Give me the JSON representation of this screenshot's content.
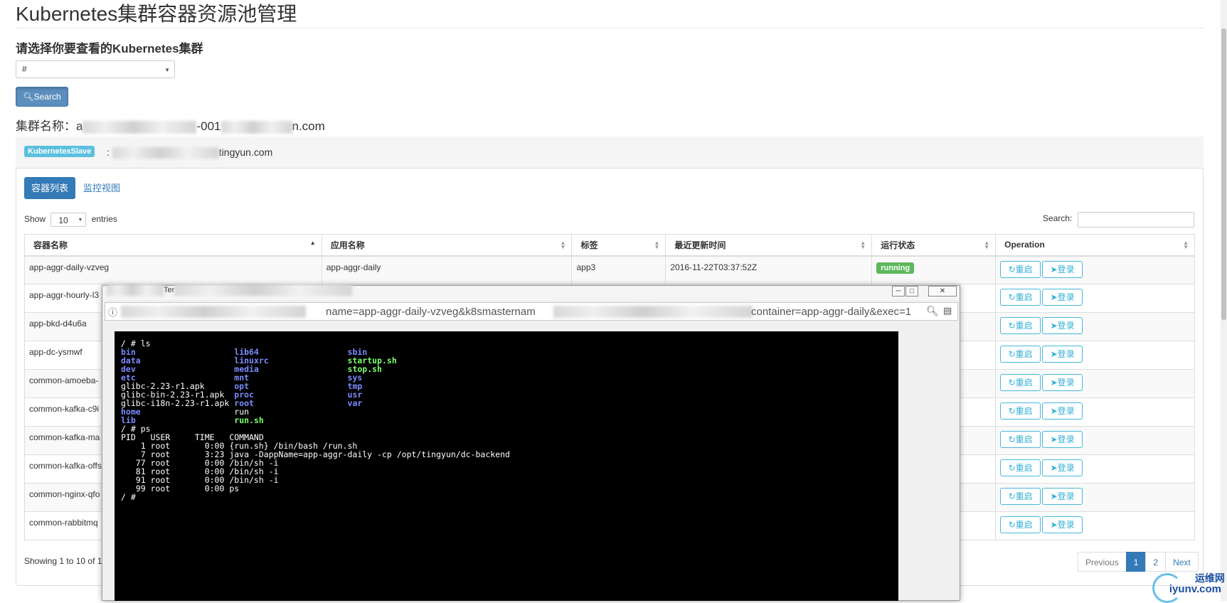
{
  "header": {
    "title": "Kubernetes集群容器资源池管理",
    "select_label": "请选择你要查看的Kubernetes集群",
    "select_value": "#",
    "search_button": "Search",
    "cluster_label": "集群名称：",
    "cluster_name_prefix": "a",
    "cluster_name_mid": "-001",
    "cluster_name_suffix": "n.com"
  },
  "panel": {
    "badge": "KubernetesSlave",
    "colon": ":",
    "host_suffix": "tingyun.com"
  },
  "tabs": {
    "list": "容器列表",
    "monitor": "监控视图"
  },
  "table_controls": {
    "show": "Show",
    "page_size": "10",
    "entries": "entries",
    "search_label": "Search:"
  },
  "table": {
    "columns": [
      "容器名称",
      "应用名称",
      "标签",
      "最近更新时间",
      "运行状态",
      "Operation"
    ],
    "rows": [
      {
        "name": "app-aggr-daily-vzveg",
        "app": "app-aggr-daily",
        "tag": "app3",
        "updated": "2016-11-22T03:37:52Z",
        "status": "running"
      },
      {
        "name": "app-aggr-hourly-l3",
        "app": "",
        "tag": "",
        "updated": "",
        "status": ""
      },
      {
        "name": "app-bkd-d4u6a",
        "app": "",
        "tag": "",
        "updated": "",
        "status": ""
      },
      {
        "name": "app-dc-ysmwf",
        "app": "",
        "tag": "",
        "updated": "",
        "status": ""
      },
      {
        "name": "common-amoeba-",
        "app": "",
        "tag": "",
        "updated": "",
        "status": ""
      },
      {
        "name": "common-kafka-c9i",
        "app": "",
        "tag": "",
        "updated": "",
        "status": ""
      },
      {
        "name": "common-kafka-ma",
        "app": "",
        "tag": "",
        "updated": "",
        "status": ""
      },
      {
        "name": "common-kafka-offs",
        "app": "",
        "tag": "",
        "updated": "",
        "status": ""
      },
      {
        "name": "common-nginx-qfo",
        "app": "",
        "tag": "",
        "updated": "",
        "status": ""
      },
      {
        "name": "common-rabbitmq",
        "app": "",
        "tag": "",
        "updated": "",
        "status": ""
      }
    ],
    "restart_label": "重启",
    "login_label": "登录"
  },
  "footer": {
    "showing": "Showing 1 to 10 of 1",
    "previous": "Previous",
    "page1": "1",
    "page2": "2",
    "next": "Next"
  },
  "popup": {
    "title_fragment": "Ter",
    "url_visible": "name=app-aggr-daily-vzveg&k8smasternam",
    "url_tail": "container=app-aggr-daily&exec=1",
    "terminal": {
      "prompt_ls": "/ # ls",
      "ls_col1": [
        [
          "bin",
          "dir"
        ],
        [
          "data",
          "dir"
        ],
        [
          "dev",
          "dir"
        ],
        [
          "etc",
          "dir"
        ],
        [
          "glibc-2.23-r1.apk",
          ""
        ],
        [
          "glibc-bin-2.23-r1.apk",
          ""
        ],
        [
          "glibc-i18n-2.23-r1.apk",
          ""
        ],
        [
          "home",
          "dir"
        ],
        [
          "lib",
          "dir"
        ]
      ],
      "ls_col2": [
        [
          "lib64",
          "dir"
        ],
        [
          "linuxrc",
          "dir"
        ],
        [
          "media",
          "dir"
        ],
        [
          "mnt",
          "dir"
        ],
        [
          "opt",
          "dir"
        ],
        [
          "proc",
          "dir"
        ],
        [
          "root",
          "dir"
        ],
        [
          "run",
          ""
        ],
        [
          "run.sh",
          "exe"
        ]
      ],
      "ls_col3": [
        [
          "sbin",
          "dir"
        ],
        [
          "startup.sh",
          "exe"
        ],
        [
          "stop.sh",
          "exe"
        ],
        [
          "sys",
          "dir"
        ],
        [
          "tmp",
          "dir"
        ],
        [
          "usr",
          "dir"
        ],
        [
          "var",
          "dir"
        ]
      ],
      "prompt_ps": "/ # ps",
      "ps_header": "PID   USER     TIME   COMMAND",
      "ps_rows": [
        "    1 root       0:00 {run.sh} /bin/bash /run.sh",
        "    7 root       3:23 java -DappName=app-aggr-daily -cp /opt/tingyun/dc-backend",
        "   77 root       0:00 /bin/sh -i",
        "   81 root       0:00 /bin/sh -i",
        "   91 root       0:00 /bin/sh -i",
        "   99 root       0:00 ps"
      ],
      "prompt_end": "/ #"
    }
  },
  "watermark": {
    "cn": "运维网",
    "en": "iyunv.com"
  },
  "colors": {
    "primary": "#337ab7",
    "info": "#5bc0de",
    "success": "#5cb85c",
    "terminal_bg": "#000000"
  }
}
